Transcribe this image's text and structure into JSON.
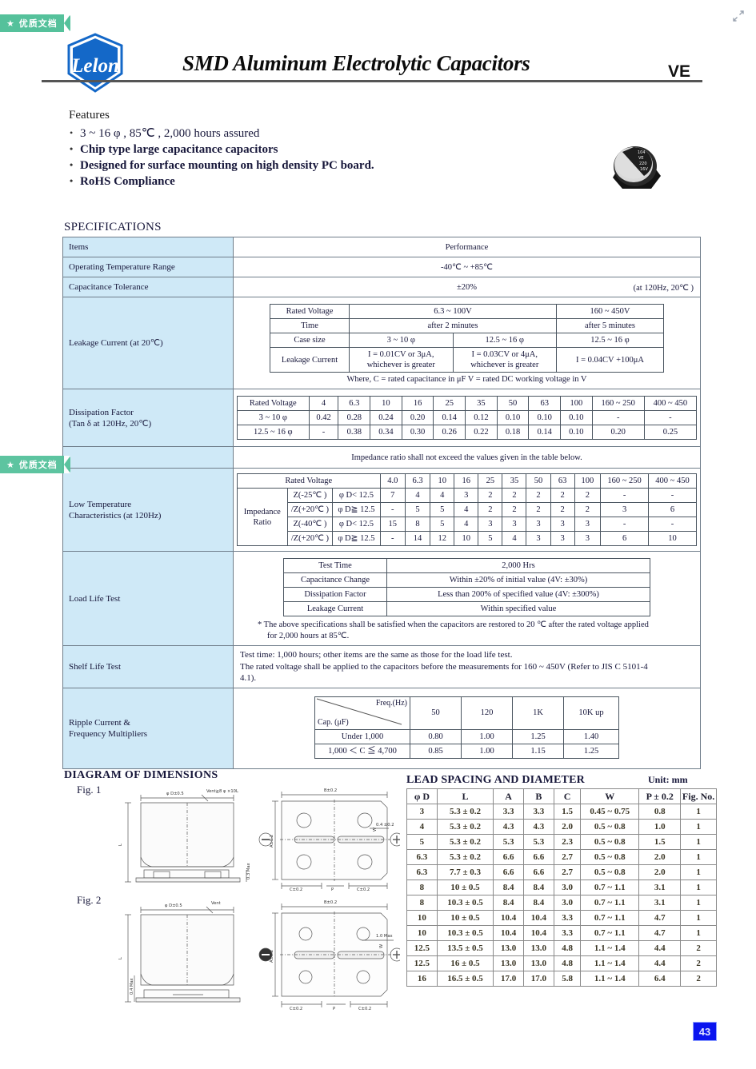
{
  "watermark": {
    "label": "★ 优质文档"
  },
  "header": {
    "title": "SMD Aluminum Electrolytic Capacitors",
    "series": "VE",
    "logo_text": "Lelon"
  },
  "features": {
    "heading": "Features",
    "items": [
      "3 ~ 16 φ , 85℃ , 2,000 hours assured",
      "Chip type large capacitance capacitors",
      "Designed for surface mounting on high density PC board.",
      "RoHS Compliance"
    ]
  },
  "specifications": {
    "heading": "SPECIFICATIONS",
    "col_items": "Items",
    "col_performance": "Performance",
    "rows": {
      "operating_temp": {
        "label": "Operating Temperature Range",
        "value": "-40℃ ~ +85℃"
      },
      "cap_tolerance": {
        "label": "Capacitance Tolerance",
        "value": "±20%",
        "note": "(at 120Hz, 20℃ )"
      },
      "leakage": {
        "label": "Leakage Current (at 20℃)",
        "table": {
          "r1": [
            "Rated Voltage",
            "6.3 ~ 100V",
            "160 ~ 450V"
          ],
          "r2": [
            "Time",
            "after 2 minutes",
            "after 5 minutes"
          ],
          "r3": [
            "Case size",
            "3 ~ 10 φ",
            "12.5 ~ 16 φ",
            "12.5 ~ 16 φ"
          ],
          "r4": [
            "Leakage Current",
            "I = 0.01CV or 3μA,\nwhichever is greater",
            "I = 0.03CV or 4μA,\nwhichever is greater",
            "I = 0.04CV +100μA"
          ]
        },
        "footnote": "Where, C = rated capacitance in μF     V = rated DC working voltage in V"
      },
      "dissipation": {
        "label_l1": "Dissipation Factor",
        "label_l2": "(Tan δ  at 120Hz, 20℃)",
        "header": [
          "Rated Voltage",
          "4",
          "6.3",
          "10",
          "16",
          "25",
          "35",
          "50",
          "63",
          "100",
          "160 ~ 250",
          "400 ~ 450"
        ],
        "row1": [
          "3 ~ 10 φ",
          "0.42",
          "0.28",
          "0.24",
          "0.20",
          "0.14",
          "0.12",
          "0.10",
          "0.10",
          "0.10",
          "-",
          "-"
        ],
        "row2": [
          "12.5 ~ 16 φ",
          "-",
          "0.38",
          "0.34",
          "0.30",
          "0.26",
          "0.22",
          "0.18",
          "0.14",
          "0.10",
          "0.20",
          "0.25"
        ]
      },
      "impedance_note": "Impedance ratio shall not exceed the values given in the table below.",
      "low_temp": {
        "label_l1": "Low Temperature",
        "label_l2": "Characteristics (at 120Hz)",
        "group_label_l1": "Impedance",
        "group_label_l2": "Ratio",
        "header": [
          "Rated Voltage",
          "4.0",
          "6.3",
          "10",
          "16",
          "25",
          "35",
          "50",
          "63",
          "100",
          "160 ~ 250",
          "400 ~ 450"
        ],
        "rows": [
          {
            "ratio": "Z(-25℃ )",
            "cond": "φ D< 12.5",
            "values": [
              "7",
              "4",
              "4",
              "3",
              "2",
              "2",
              "2",
              "2",
              "2",
              "-",
              "-"
            ]
          },
          {
            "ratio": "/Z(+20℃ )",
            "cond": "φ D≧ 12.5",
            "values": [
              "-",
              "5",
              "5",
              "4",
              "2",
              "2",
              "2",
              "2",
              "2",
              "3",
              "6"
            ]
          },
          {
            "ratio": "Z(-40℃ )",
            "cond": "φ D< 12.5",
            "values": [
              "15",
              "8",
              "5",
              "4",
              "3",
              "3",
              "3",
              "3",
              "3",
              "-",
              "-"
            ]
          },
          {
            "ratio": "/Z(+20℃ )",
            "cond": "φ D≧ 12.5",
            "values": [
              "-",
              "14",
              "12",
              "10",
              "5",
              "4",
              "3",
              "3",
              "3",
              "6",
              "10"
            ]
          }
        ]
      },
      "load_life": {
        "label": "Load Life Test",
        "table": [
          [
            "Test Time",
            "2,000 Hrs"
          ],
          [
            "Capacitance Change",
            "Within ±20% of initial value (4V: ±30%)"
          ],
          [
            "Dissipation Factor",
            "Less than 200% of specified value (4V: ±300%)"
          ],
          [
            "Leakage Current",
            "Within specified value"
          ]
        ],
        "footnote_l1": "* The above specifications shall be satisfied when the capacitors are restored to 20 ℃ after the rated voltage applied",
        "footnote_l2": "for 2,000 hours at 85℃."
      },
      "shelf_life": {
        "label": "Shelf Life Test",
        "l1": "Test time: 1,000 hours; other items are the same as those for the load life test.",
        "l2": "The rated voltage shall be applied to the capacitors before the measurements for 160 ~ 450V (Refer to JIS C 5101-4",
        "l3": "4.1)."
      },
      "ripple": {
        "label_l1": "Ripple Current &",
        "label_l2": "Frequency Multipliers",
        "corner_top": "Freq.(Hz)",
        "corner_bottom": "Cap. (μF)",
        "freqs": [
          "50",
          "120",
          "1K",
          "10K up"
        ],
        "rows": [
          {
            "cap": "Under 1,000",
            "values": [
              "0.80",
              "1.00",
              "1.25",
              "1.40"
            ]
          },
          {
            "cap": "1,000 ＜ C ≦ 4,700",
            "values": [
              "0.85",
              "1.00",
              "1.15",
              "1.25"
            ]
          }
        ]
      }
    }
  },
  "diagram": {
    "heading": "DIAGRAM OF DIMENSIONS",
    "fig1_label": "Fig. 1",
    "fig2_label": "Fig. 2",
    "fig1": {
      "d": "φ D±0.5",
      "vent": "Vent≧8 φ ×10L",
      "l": "L",
      "seat": "0.3 Max",
      "b": "B±0.2",
      "a": "A±0.2",
      "w": "W",
      "c_left": "C±0.2",
      "p": "P",
      "c_right": "C±0.2",
      "lead_h": "0.4 ±0.2"
    },
    "fig2": {
      "d": "φ D±0.5",
      "vent": "Vent",
      "l": "L",
      "seat": "0.4 Max",
      "b": "B±0.2",
      "a": "A±0.2",
      "w": "W",
      "c_left": "C±0.2",
      "p": "P",
      "c_right": "C±0.2",
      "lead_h": "1.0 Max"
    }
  },
  "lead_spacing": {
    "heading": "LEAD SPACING AND DIAMETER",
    "unit": "Unit: mm",
    "columns": [
      "φ D",
      "L",
      "A",
      "B",
      "C",
      "W",
      "P ± 0.2",
      "Fig. No."
    ],
    "rows": [
      [
        "3",
        "5.3 ± 0.2",
        "3.3",
        "3.3",
        "1.5",
        "0.45 ~ 0.75",
        "0.8",
        "1"
      ],
      [
        "4",
        "5.3 ± 0.2",
        "4.3",
        "4.3",
        "2.0",
        "0.5 ~ 0.8",
        "1.0",
        "1"
      ],
      [
        "5",
        "5.3 ± 0.2",
        "5.3",
        "5.3",
        "2.3",
        "0.5 ~ 0.8",
        "1.5",
        "1"
      ],
      [
        "6.3",
        "5.3 ± 0.2",
        "6.6",
        "6.6",
        "2.7",
        "0.5 ~ 0.8",
        "2.0",
        "1"
      ],
      [
        "6.3",
        "7.7 ± 0.3",
        "6.6",
        "6.6",
        "2.7",
        "0.5 ~ 0.8",
        "2.0",
        "1"
      ],
      [
        "8",
        "10 ± 0.5",
        "8.4",
        "8.4",
        "3.0",
        "0.7 ~ 1.1",
        "3.1",
        "1"
      ],
      [
        "8",
        "10.3 ± 0.5",
        "8.4",
        "8.4",
        "3.0",
        "0.7 ~ 1.1",
        "3.1",
        "1"
      ],
      [
        "10",
        "10 ± 0.5",
        "10.4",
        "10.4",
        "3.3",
        "0.7 ~ 1.1",
        "4.7",
        "1"
      ],
      [
        "10",
        "10.3 ± 0.5",
        "10.4",
        "10.4",
        "3.3",
        "0.7 ~ 1.1",
        "4.7",
        "1"
      ],
      [
        "12.5",
        "13.5 ± 0.5",
        "13.0",
        "13.0",
        "4.8",
        "1.1 ~ 1.4",
        "4.4",
        "2"
      ],
      [
        "12.5",
        "16 ± 0.5",
        "13.0",
        "13.0",
        "4.8",
        "1.1 ~ 1.4",
        "4.4",
        "2"
      ],
      [
        "16",
        "16.5 ± 0.5",
        "17.0",
        "17.0",
        "5.8",
        "1.1 ~ 1.4",
        "6.4",
        "2"
      ]
    ]
  },
  "page_number": "43",
  "colors": {
    "label_blue": "#cfe9f7",
    "page_badge": "#0a14ef",
    "watermark_green": "#55c19b",
    "logo_blue": "#1468c8"
  }
}
